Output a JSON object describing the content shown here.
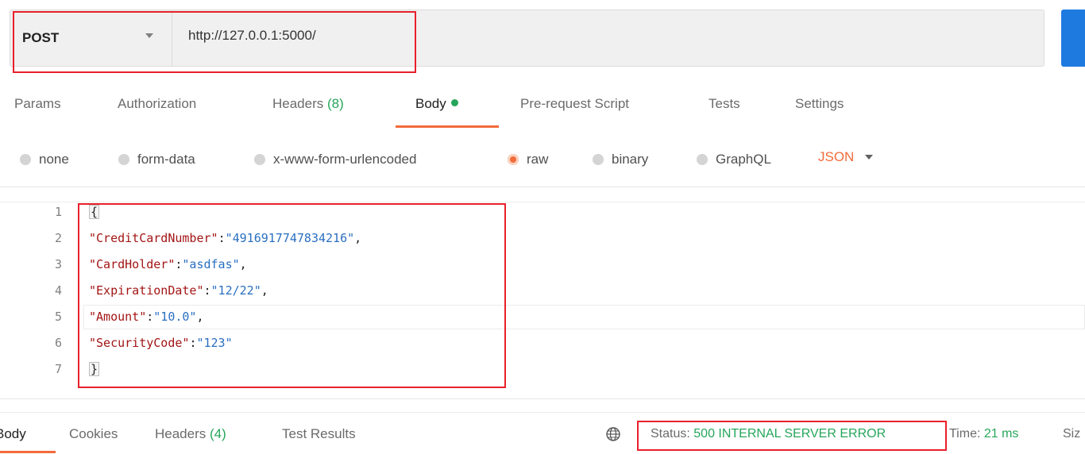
{
  "request": {
    "method": "POST",
    "url": "http://127.0.0.1:5000/"
  },
  "tabs": {
    "params": "Params",
    "authorization": "Authorization",
    "headers": "Headers",
    "headers_count": "(8)",
    "body": "Body",
    "prerequest": "Pre-request Script",
    "tests": "Tests",
    "settings": "Settings"
  },
  "body_types": {
    "none": "none",
    "form_data": "form-data",
    "urlencoded": "x-www-form-urlencoded",
    "raw": "raw",
    "binary": "binary",
    "graphql": "GraphQL",
    "language": "JSON",
    "selected": "raw"
  },
  "editor": {
    "line_numbers": [
      "1",
      "2",
      "3",
      "4",
      "5",
      "6",
      "7"
    ],
    "open_brace": "{",
    "close_brace": "}",
    "fields": [
      {
        "key": "\"CreditCardNumber\"",
        "value": "\"4916917747834216\"",
        "trail": ","
      },
      {
        "key": "\"CardHolder\"",
        "value": "\"asdfas\"",
        "trail": ","
      },
      {
        "key": "\"ExpirationDate\"",
        "value": "\"12/22\"",
        "trail": ","
      },
      {
        "key": "\"Amount\"",
        "value": "\"10.0\"",
        "trail": ","
      },
      {
        "key": "\"SecurityCode\"",
        "value": "\"123\"",
        "trail": ""
      }
    ],
    "colon": ":"
  },
  "response": {
    "tabs": {
      "body": "Body",
      "cookies": "Cookies",
      "headers": "Headers",
      "headers_count": "(4)",
      "test_results": "Test Results"
    },
    "status_label": "Status:",
    "status_value": "500 INTERNAL SERVER ERROR",
    "time_label": "Time:",
    "time_value": "21 ms",
    "size_label": "Siz"
  },
  "colors": {
    "accent": "#f26b3a",
    "success": "#26a65b",
    "highlight_box": "#e8202a",
    "send_button": "#1f7ae0"
  }
}
